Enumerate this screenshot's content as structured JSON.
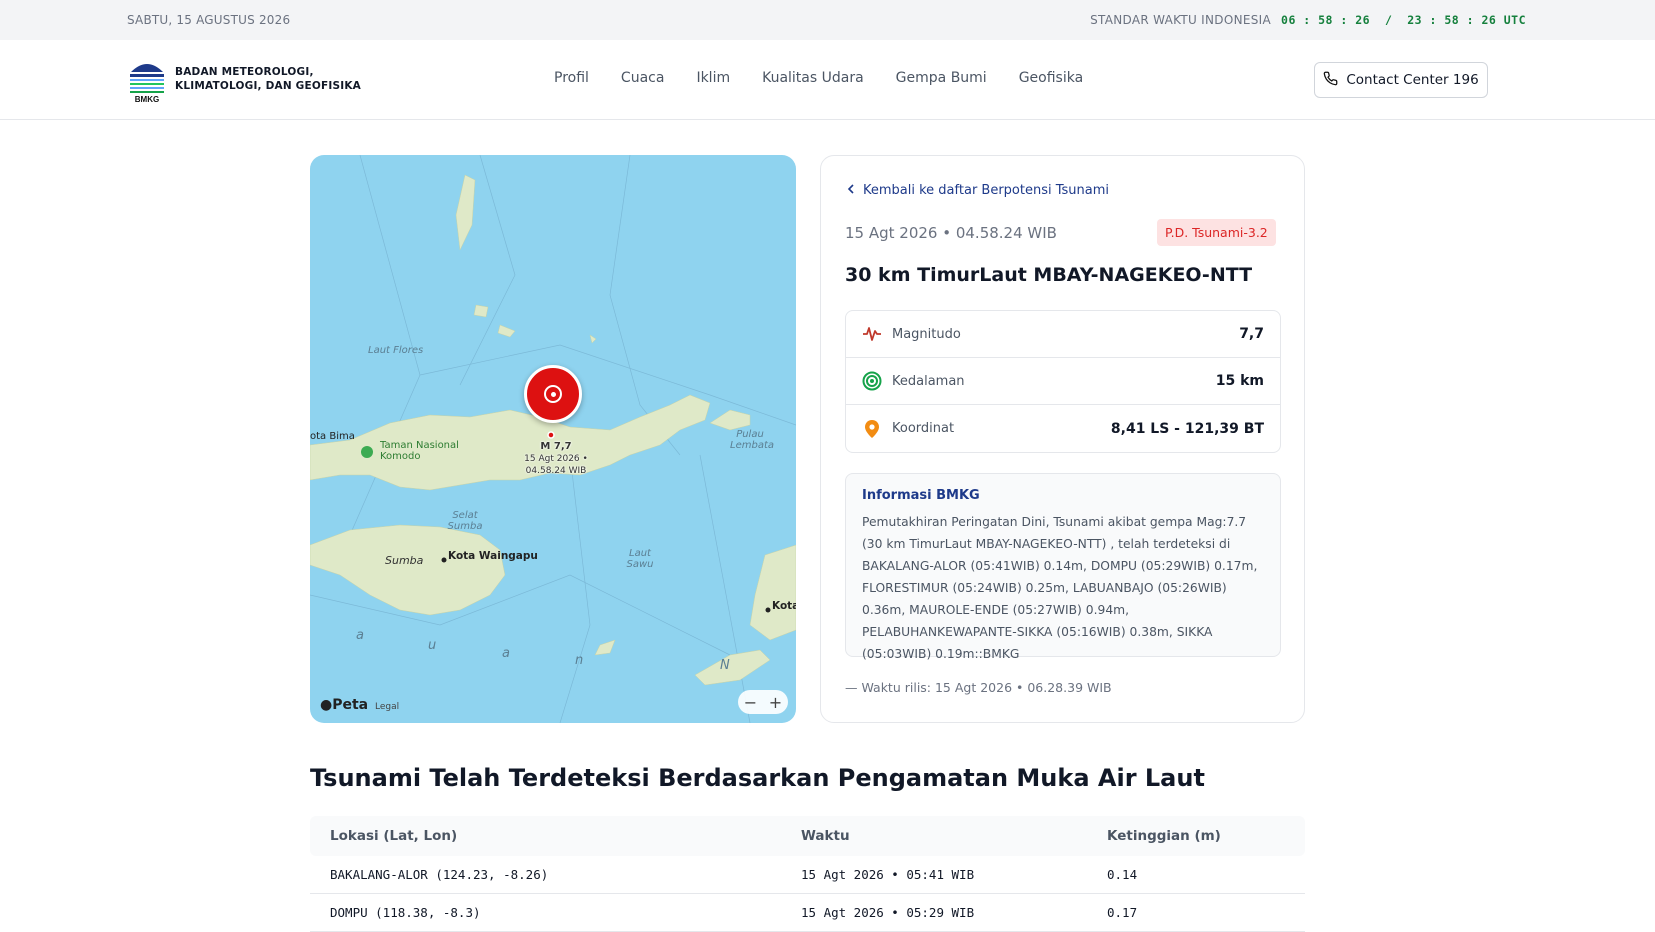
{
  "topbar": {
    "date": "SABTU, 15 AGUSTUS 2026",
    "standard": "STANDAR WAKTU INDONESIA",
    "clock": "06 : 58 : 26  /  23 : 58 : 26 UTC"
  },
  "header": {
    "org_line1": "BADAN METEOROLOGI,",
    "org_line2": "KLIMATOLOGI, DAN GEOFISIKA",
    "logo_text": "BMKG",
    "nav": [
      "Profil",
      "Cuaca",
      "Iklim",
      "Kualitas Udara",
      "Gempa Bumi",
      "Geofisika"
    ],
    "contact_label": "Contact Center 196"
  },
  "map": {
    "labels": {
      "laut_flores": "Laut Flores",
      "taman": "Taman Nasional Komodo",
      "kota_bima": "ota Bima",
      "selat_sumba": "Selat Sumba",
      "sumba": "Sumba",
      "kota_waingapu": "Kota Waingapu",
      "laut_sawu": "Laut Sawu",
      "pulau_lembata": "Pulau Lembata",
      "kota": "Kota",
      "sea_a1": "a",
      "sea_u": "u",
      "sea_a2": "a",
      "sea_n": "n",
      "sea_N": "N"
    },
    "eq_mag": "M 7,7",
    "eq_date": "15 Agt 2026 •",
    "eq_time": "04.58.24 WIB",
    "attribution": "Peta",
    "legal": "Legal",
    "zoom_out": "−",
    "zoom_in": "+"
  },
  "card": {
    "back_label": "Kembali ke daftar Berpotensi Tsunami",
    "time": "15 Agt 2026 • 04.58.24 WIB",
    "badge": "P.D. Tsunami-3.2",
    "place": "30 km TimurLaut MBAY-NAGEKEO-NTT",
    "stats": [
      {
        "label": "Magnitudo",
        "value": "7,7",
        "icon": "pulse-icon"
      },
      {
        "label": "Kedalaman",
        "value": "15 km",
        "icon": "target-icon"
      },
      {
        "label": "Koordinat",
        "value": "8,41 LS - 121,39 BT",
        "icon": "map-pin-icon"
      }
    ],
    "info_title": "Informasi BMKG",
    "info_text": "Pemutakhiran Peringatan Dini, Tsunami akibat gempa Mag:7.7 (30 km TimurLaut MBAY-NAGEKEO-NTT) , telah terdeteksi di BAKALANG-ALOR (05:41WIB) 0.14m, DOMPU (05:29WIB) 0.17m, FLORESTIMUR (05:24WIB) 0.25m, LABUANBAJO (05:26WIB) 0.36m, MAUROLE-ENDE (05:27WIB) 0.94m, PELABUHANKEWAPANTE-SIKKA (05:16WIB) 0.38m, SIKKA (05:03WIB) 0.19m::BMKG",
    "release": "— Waktu rilis: 15 Agt 2026 • 06.28.39 WIB"
  },
  "section": {
    "title": "Tsunami Telah Terdeteksi Berdasarkan Pengamatan Muka Air Laut",
    "headers": [
      "Lokasi (Lat, Lon)",
      "Waktu",
      "Ketinggian (m)"
    ],
    "rows": [
      [
        "BAKALANG-ALOR (124.23, -8.26)",
        "15 Agt 2026 • 05:41 WIB",
        "0.14"
      ],
      [
        "DOMPU (118.38, -8.3)",
        "15 Agt 2026 • 05:29 WIB",
        "0.17"
      ]
    ]
  },
  "colors": {
    "accent": "#1e3a8a",
    "badge_bg": "#fde2e2",
    "badge_text": "#dc2626",
    "clock": "#15803d",
    "marker": "#dd1111"
  }
}
